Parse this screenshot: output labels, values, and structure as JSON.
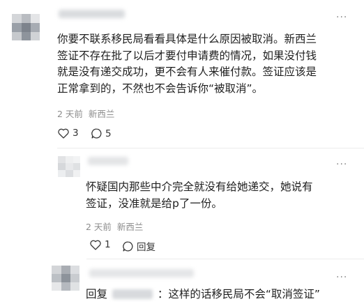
{
  "comments": [
    {
      "text_lines": [
        "你要不联系移民局看看具体是什么原因被取消。新西兰",
        "签证不存在批了以后才要付申请费的情况，如果没付钱",
        "就是没有递交成功，更不会有人来催付款。签证应该是",
        "正常拿到的，不然也不会告诉你“被取消”。"
      ],
      "time": "2 天前",
      "location": "新西兰",
      "like_count": "3",
      "reply_count": "5"
    },
    {
      "text_lines": [
        "怀疑国内那些中介完全就没有给她递交，她说有",
        "签证，没准就是给p了一份。"
      ],
      "time": "2 天前",
      "location": "新西兰",
      "like_count": "1",
      "reply_label": "回复"
    },
    {
      "reply_prefix": "回复",
      "reply_suffix": "：这样的话移民局不会“取消签证”"
    }
  ],
  "icons": [
    "more-icon",
    "heart-icon",
    "comment-icon"
  ],
  "colors": {
    "text": "#1f1f1f",
    "meta": "#8c8c8c",
    "icon": "#333333"
  }
}
